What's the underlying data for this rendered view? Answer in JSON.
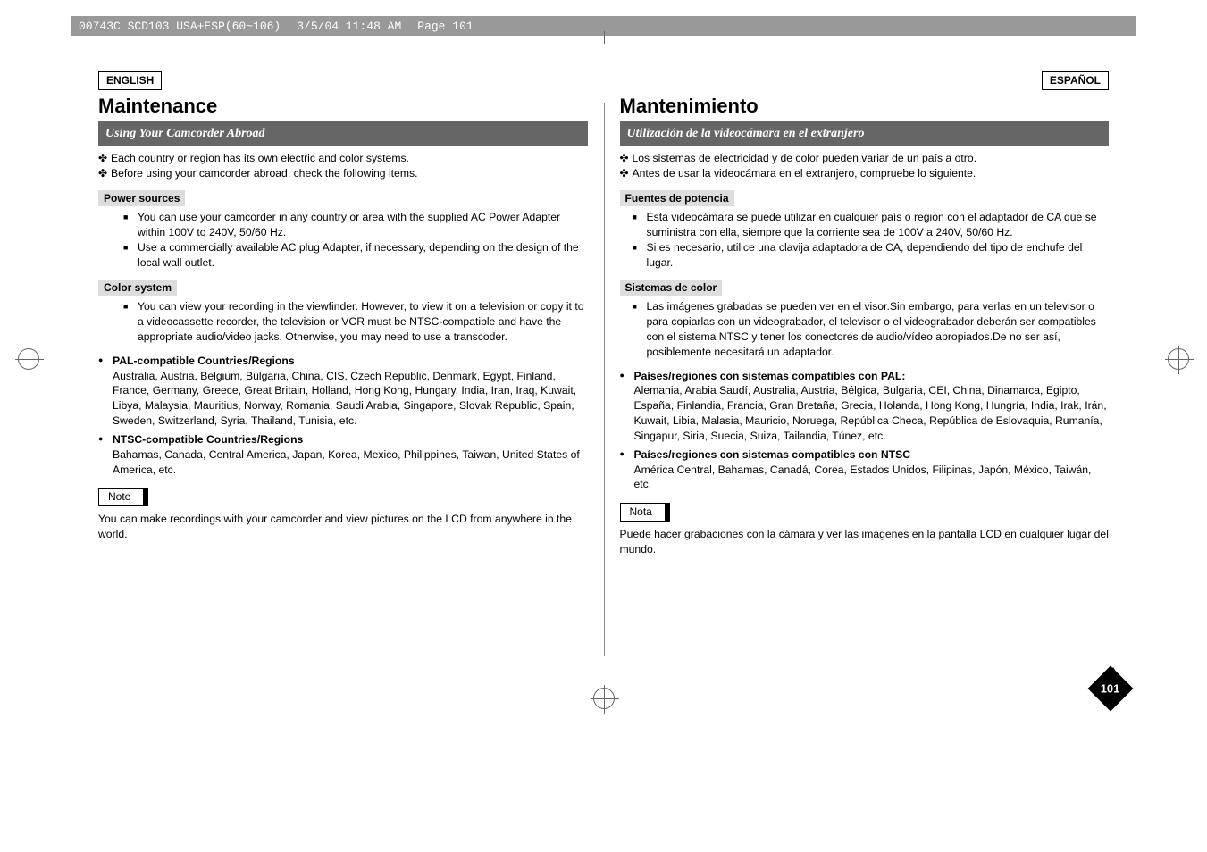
{
  "header": {
    "file": "00743C SCD103 USA+ESP(60~106)",
    "date": "3/5/04 11:48 AM",
    "page": "Page 101"
  },
  "pageNumber": "101",
  "left": {
    "lang": "ENGLISH",
    "heading": "Maintenance",
    "band": "Using Your Camcorder Abroad",
    "intro": [
      "Each country or region has its own electric and color systems.",
      "Before using your camcorder abroad, check the following items."
    ],
    "power": {
      "label": "Power sources",
      "items": [
        "You can use your camcorder in any country or area with the supplied AC Power Adapter within 100V to 240V, 50/60 Hz.",
        "Use a commercially available AC plug Adapter, if necessary, depending on the design of the local wall outlet."
      ]
    },
    "color": {
      "label": "Color system",
      "items": [
        "You can view your recording in the viewfinder. However, to view it on a television or copy it to a videocassette recorder, the television or VCR must be NTSC-compatible and have the appropriate audio/video jacks. Otherwise, you may need to use a transcoder."
      ]
    },
    "regions": [
      {
        "title": "PAL-compatible Countries/Regions",
        "body": "Australia, Austria, Belgium, Bulgaria, China, CIS, Czech Republic, Denmark, Egypt, Finland, France, Germany, Greece, Great Britain, Holland, Hong Kong, Hungary, India, Iran, Iraq, Kuwait, Libya, Malaysia, Mauritius, Norway, Romania, Saudi Arabia, Singapore, Slovak Republic, Spain, Sweden, Switzerland, Syria, Thailand, Tunisia, etc."
      },
      {
        "title": "NTSC-compatible Countries/Regions",
        "body": "Bahamas, Canada, Central America, Japan, Korea, Mexico, Philippines, Taiwan, United States of America, etc."
      }
    ],
    "noteLabel": "Note",
    "noteBody": "You can make recordings with your camcorder and view pictures on the LCD from anywhere in the world."
  },
  "right": {
    "lang": "ESPAÑOL",
    "heading": "Mantenimiento",
    "band": "Utilización de la videocámara en el extranjero",
    "intro": [
      "Los sistemas de electricidad y de color pueden variar de un país a otro.",
      "Antes de usar la videocámara en el extranjero, compruebe lo siguiente."
    ],
    "power": {
      "label": "Fuentes de potencia",
      "items": [
        "Esta videocámara se puede utilizar en cualquier país o región con el adaptador de CA que se suministra con ella, siempre que la corriente sea de 100V a 240V, 50/60 Hz.",
        "Si es necesario, utilice una clavija adaptadora de CA, dependiendo del tipo de enchufe del lugar."
      ]
    },
    "color": {
      "label": "Sistemas de color",
      "items": [
        "Las imágenes grabadas se pueden ver en el visor.Sin embargo, para verlas en un televisor o para copiarlas con un videograbador, el televisor o el videograbador deberán ser compatibles con el sistema NTSC y tener los conectores de audio/vídeo apropiados.De no ser así, posiblemente necesitará un adaptador."
      ]
    },
    "regions": [
      {
        "title": "Países/regiones con sistemas compatibles con PAL:",
        "body": "Alemania, Arabia Saudí, Australia, Austria, Bélgica, Bulgaria, CEI, China, Dinamarca, Egipto, España, Finlandia, Francia, Gran Bretaña, Grecia, Holanda, Hong Kong, Hungría, India, Irak, Irán, Kuwait, Libia, Malasia, Mauricio, Noruega, República Checa, República de Eslovaquia, Rumanía, Singapur, Siria, Suecia, Suiza, Tailandia, Túnez, etc."
      },
      {
        "title": "Países/regiones con sistemas compatibles con NTSC",
        "body": "América Central, Bahamas, Canadá, Corea, Estados Unidos, Filipinas, Japón, México, Taiwán, etc."
      }
    ],
    "noteLabel": "Nota",
    "noteBody": "Puede hacer grabaciones con la cámara y ver las imágenes en la pantalla LCD en cualquier lugar del mundo."
  }
}
